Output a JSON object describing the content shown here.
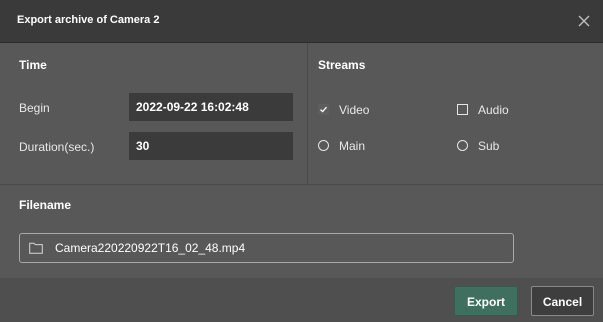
{
  "dialog": {
    "title": "Export archive of Camera 2",
    "close_icon": "close-icon"
  },
  "time": {
    "section_title": "Time",
    "begin_label": "Begin",
    "begin_value": "2022-09-22 16:02:48",
    "duration_label": "Duration(sec.)",
    "duration_value": "30"
  },
  "streams": {
    "section_title": "Streams",
    "video_label": "Video",
    "video_checked": true,
    "audio_label": "Audio",
    "audio_checked": false,
    "main_label": "Main",
    "sub_label": "Sub"
  },
  "filename": {
    "section_title": "Filename",
    "icon": "folder-icon",
    "value": "Camera220220922T16_02_48.mp4"
  },
  "footer": {
    "export_label": "Export",
    "cancel_label": "Cancel"
  },
  "colors": {
    "dialog_bg": "#585858",
    "titlebar_bg": "#3a3a3a",
    "field_bg": "#3b3b3b",
    "export_button": "#3f6f5e",
    "cancel_button": "#3e3e3e"
  }
}
